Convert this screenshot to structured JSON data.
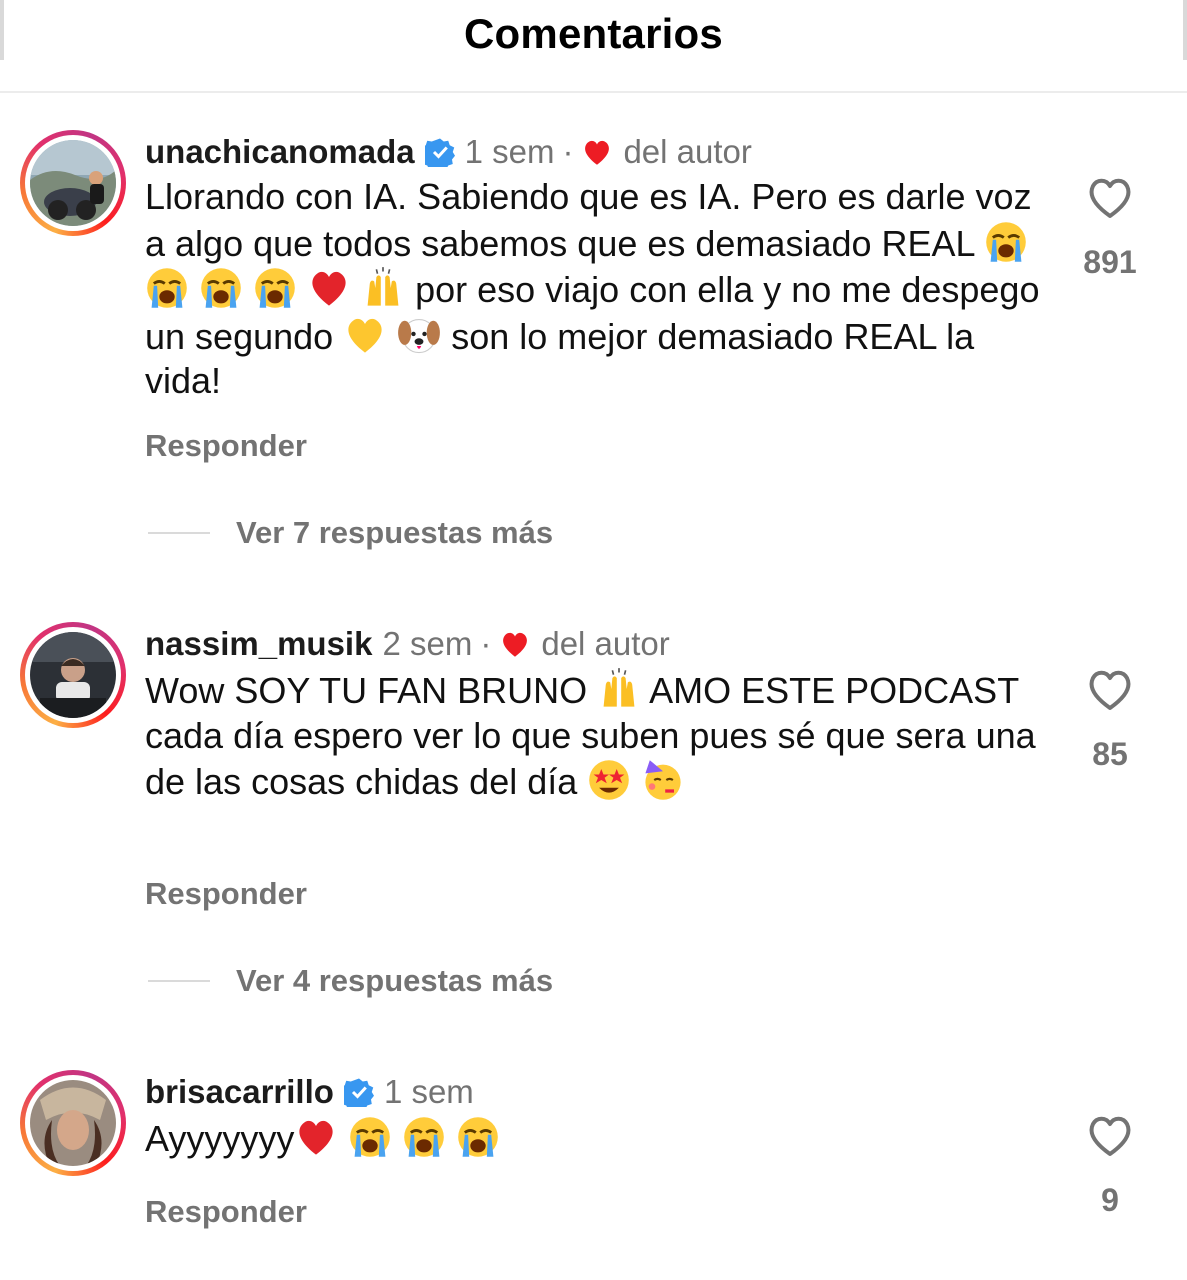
{
  "header": {
    "title": "Comentarios"
  },
  "comments": [
    {
      "username": "unachicanomada",
      "verified": true,
      "time": "1 sem",
      "separator": "·",
      "author_label": "del autor",
      "text_segments": [
        "Llorando con IA. Sabiendo que es IA. Pero es darle voz a algo que todos sabemos que es demasiado REAL",
        "por eso viajo con ella y no me despego un segundo",
        "son lo mejor demasiado REAL la vida!"
      ],
      "reply_label": "Responder",
      "likes": "891",
      "view_more": "Ver 7 respuestas más"
    },
    {
      "username": "nassim_musik",
      "verified": false,
      "time": "2 sem",
      "separator": "·",
      "author_label": "del autor",
      "text_segments": [
        "Wow SOY TU FAN BRUNO",
        "AMO ESTE PODCAST cada día espero ver lo que suben pues sé que sera una de las cosas chidas del día"
      ],
      "reply_label": "Responder",
      "likes": "85",
      "view_more": "Ver 4 respuestas más"
    },
    {
      "username": "brisacarrillo",
      "verified": true,
      "time": "1 sem",
      "text_segments": [
        "Ayyyyyyy"
      ],
      "reply_label": "Responder",
      "likes": "9"
    }
  ],
  "icons": {
    "like": "heart-outline-icon",
    "author_like": "heart-filled-icon",
    "verified": "verified-badge-icon",
    "emoji": [
      "loudly-crying-face",
      "red-heart",
      "raising-hands",
      "yellow-heart",
      "dog-face",
      "star-struck",
      "partying-face"
    ]
  },
  "colors": {
    "heart": "#ed1c24",
    "verified": "#3897f0",
    "muted_text": "#737373"
  }
}
